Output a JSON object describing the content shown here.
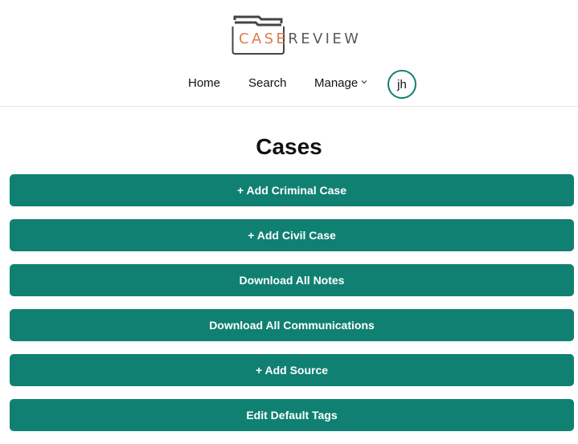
{
  "logo": {
    "case": "CASE",
    "review": "REVIEW",
    "icon": "folder-icon",
    "colors": {
      "case": "#e07a4a",
      "review": "#5a5a5a",
      "folder_dark": "#444444"
    }
  },
  "nav": {
    "home": "Home",
    "search": "Search",
    "manage": "Manage",
    "manage_icon": "chevron-down-icon",
    "avatar_initials": "jh"
  },
  "page": {
    "title": "Cases"
  },
  "actions": [
    {
      "label": "+ Add Criminal Case"
    },
    {
      "label": "+ Add Civil Case"
    },
    {
      "label": "Download All Notes"
    },
    {
      "label": "Download All Communications"
    },
    {
      "label": "+ Add Source"
    },
    {
      "label": "Edit Default Tags"
    }
  ],
  "colors": {
    "accent": "#108072",
    "button_text": "#ffffff",
    "divider": "#e3e3e3"
  }
}
